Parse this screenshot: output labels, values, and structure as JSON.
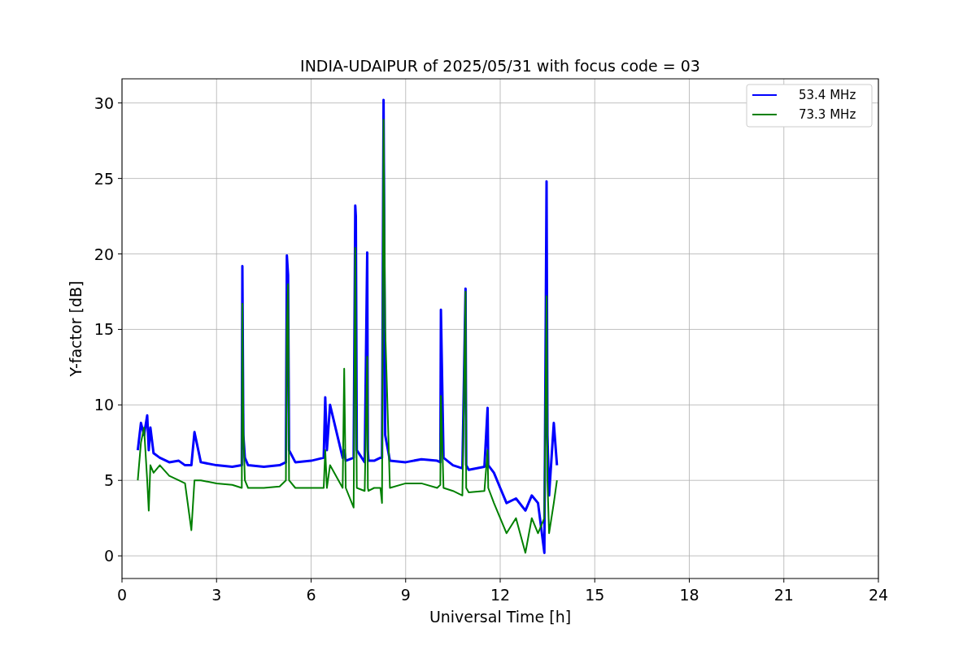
{
  "figure": {
    "chart_data": {
      "type": "line",
      "title": "INDIA-UDAIPUR of 2025/05/31 with focus code = 03",
      "xlabel": "Universal Time [h]",
      "ylabel": "Y-factor [dB]",
      "xlim": [
        0,
        24
      ],
      "ylim": [
        -1.5,
        31.6
      ],
      "grid": true,
      "legend": true,
      "xticks": [
        0,
        3,
        6,
        9,
        12,
        15,
        18,
        21,
        24
      ],
      "yticks": [
        0,
        5,
        10,
        15,
        20,
        25,
        30
      ],
      "x": [
        0.5,
        0.6,
        0.7,
        0.8,
        0.85,
        0.9,
        1.0,
        1.2,
        1.5,
        1.8,
        2.0,
        2.2,
        2.3,
        2.5,
        3.0,
        3.5,
        3.8,
        3.82,
        3.85,
        3.9,
        4.0,
        4.5,
        5.0,
        5.2,
        5.23,
        5.27,
        5.3,
        5.5,
        6.0,
        6.4,
        6.45,
        6.5,
        6.6,
        7.0,
        7.05,
        7.1,
        7.35,
        7.4,
        7.42,
        7.45,
        7.7,
        7.78,
        7.8,
        7.82,
        8.0,
        8.2,
        8.25,
        8.3,
        8.35,
        8.5,
        9.0,
        9.5,
        10.0,
        10.1,
        10.12,
        10.2,
        10.5,
        10.8,
        10.9,
        10.92,
        11.0,
        11.5,
        11.6,
        11.62,
        11.8,
        12.0,
        12.2,
        12.5,
        12.8,
        13.0,
        13.2,
        13.4,
        13.47,
        13.5,
        13.55,
        13.7,
        13.8
      ],
      "series": [
        {
          "name": "53.4 MHz",
          "color": "#0000ff",
          "values": [
            7,
            8.8,
            8,
            9.3,
            7,
            8.5,
            6.8,
            6.5,
            6.2,
            6.3,
            6.0,
            6.0,
            8.2,
            6.2,
            6.0,
            5.9,
            6,
            19.2,
            8,
            6.5,
            6,
            5.9,
            6.0,
            6.2,
            19.9,
            18.6,
            7,
            6.2,
            6.3,
            6.5,
            10.5,
            7,
            10,
            6.5,
            7,
            6.3,
            6.5,
            23.2,
            22.5,
            7,
            6.2,
            20.1,
            7,
            6.3,
            6.3,
            6.5,
            6.5,
            30.2,
            8,
            6.3,
            6.2,
            6.4,
            6.3,
            6.2,
            16.3,
            6.5,
            6.0,
            5.8,
            17.7,
            6,
            5.7,
            5.9,
            9.8,
            6,
            5.5,
            4.5,
            3.5,
            3.8,
            3.0,
            4.0,
            3.5,
            0.2,
            24.8,
            8,
            4,
            8.8,
            6
          ]
        },
        {
          "name": "73.3 MHz",
          "color": "#008000",
          "values": [
            5,
            7.5,
            8.5,
            5,
            3,
            6,
            5.5,
            6,
            5.3,
            5,
            4.8,
            1.7,
            5,
            5,
            4.8,
            4.7,
            4.5,
            16.7,
            8.3,
            5,
            4.5,
            4.5,
            4.6,
            5,
            15.2,
            18,
            5,
            4.5,
            4.5,
            4.5,
            7,
            4.5,
            6,
            4.5,
            12.4,
            4.5,
            3.2,
            20.4,
            13.7,
            4.5,
            4.3,
            13.2,
            4.5,
            4.3,
            4.5,
            4.5,
            3.5,
            28.9,
            15,
            4.5,
            4.8,
            4.8,
            4.5,
            4.7,
            10.6,
            4.5,
            4.3,
            4.0,
            17.5,
            4.5,
            4.2,
            4.3,
            7,
            4.5,
            3.5,
            2.5,
            1.5,
            2.5,
            0.2,
            2.5,
            1.5,
            2.5,
            17.2,
            5,
            1.5,
            3.5,
            5
          ]
        }
      ]
    }
  }
}
